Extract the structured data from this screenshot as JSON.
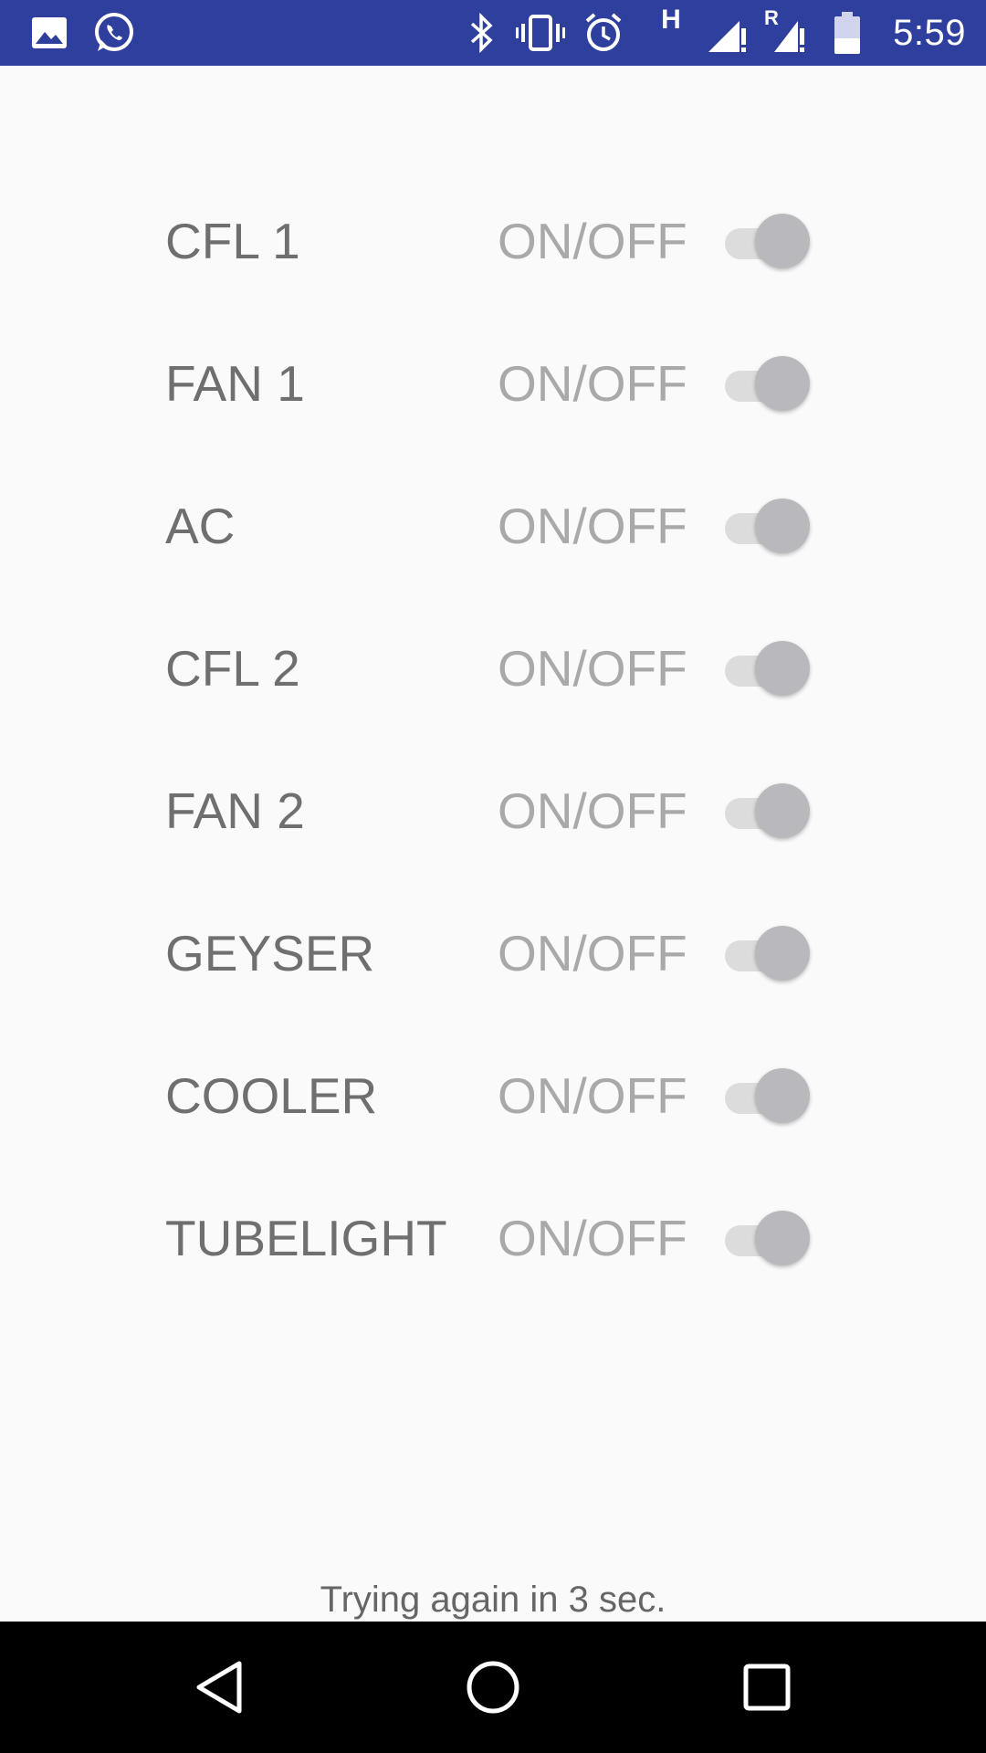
{
  "status_bar": {
    "time": "5:59",
    "network_type": "H",
    "roaming": "R",
    "left_icons": [
      "image-icon",
      "whatsapp-icon"
    ],
    "right_icons": [
      "bluetooth-icon",
      "vibrate-icon",
      "alarm-icon",
      "signal-icon",
      "signal-roaming-icon",
      "battery-icon"
    ],
    "color": "#2f3f9e"
  },
  "devices": [
    {
      "name": "CFL 1",
      "toggle_label": "ON/OFF",
      "on": false
    },
    {
      "name": "FAN 1",
      "toggle_label": "ON/OFF",
      "on": false
    },
    {
      "name": "AC",
      "toggle_label": "ON/OFF",
      "on": false
    },
    {
      "name": "CFL 2",
      "toggle_label": "ON/OFF",
      "on": false
    },
    {
      "name": "FAN 2",
      "toggle_label": "ON/OFF",
      "on": false
    },
    {
      "name": "GEYSER",
      "toggle_label": "ON/OFF",
      "on": false
    },
    {
      "name": "COOLER",
      "toggle_label": "ON/OFF",
      "on": false
    },
    {
      "name": "TUBELIGHT",
      "toggle_label": "ON/OFF",
      "on": false
    }
  ],
  "toast": {
    "text": "Trying again in 3 sec."
  },
  "nav_bar": {
    "buttons": [
      "back-icon",
      "home-icon",
      "recents-icon"
    ]
  }
}
